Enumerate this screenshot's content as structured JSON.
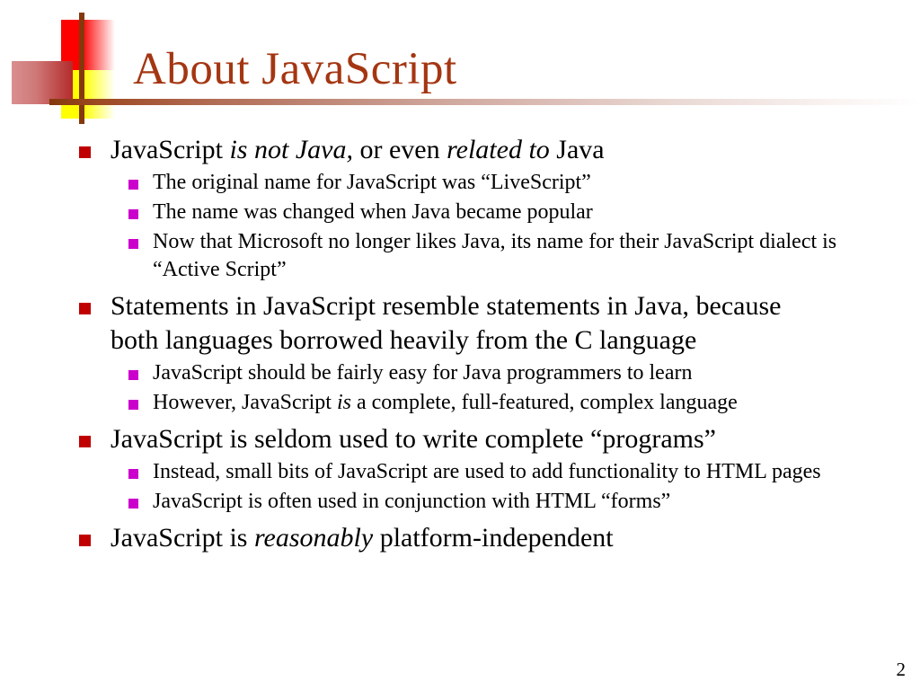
{
  "slide": {
    "title": "About JavaScript",
    "page_number": "2",
    "colors": {
      "title": "#a43612",
      "rule": "#85380c",
      "level1_bullet": "#c00000",
      "level2_bullet": "#cc00cc",
      "logo_red": "#fe0000",
      "logo_yellow": "#ffff00",
      "logo_rose": "#cf7878",
      "logo_cross": "#85380c",
      "text": "#000000",
      "background": "#ffffff"
    },
    "bullets": [
      {
        "level": 1,
        "runs": [
          {
            "text": "JavaScript ",
            "italic": false
          },
          {
            "text": "is not Java,",
            "italic": true
          },
          {
            "text": " or even ",
            "italic": false
          },
          {
            "text": "related to",
            "italic": true
          },
          {
            "text": " Java",
            "italic": false
          }
        ]
      },
      {
        "level": 2,
        "runs": [
          {
            "text": "The original name for JavaScript was “LiveScript”",
            "italic": false
          }
        ]
      },
      {
        "level": 2,
        "runs": [
          {
            "text": "The name was changed when Java became popular",
            "italic": false
          }
        ]
      },
      {
        "level": 2,
        "runs": [
          {
            "text": "Now that Microsoft no longer likes Java, its name for their JavaScript dialect is “Active Script”",
            "italic": false
          }
        ]
      },
      {
        "level": 1,
        "runs": [
          {
            "text": "Statements in JavaScript resemble statements in Java, because both languages borrowed heavily from the C language",
            "italic": false
          }
        ]
      },
      {
        "level": 2,
        "runs": [
          {
            "text": "JavaScript should be fairly easy for Java programmers to learn",
            "italic": false
          }
        ]
      },
      {
        "level": 2,
        "runs": [
          {
            "text": "However, JavaScript ",
            "italic": false
          },
          {
            "text": "is",
            "italic": true
          },
          {
            "text": " a complete, full-featured, complex language",
            "italic": false
          }
        ]
      },
      {
        "level": 1,
        "runs": [
          {
            "text": "JavaScript is seldom used to write complete “programs”",
            "italic": false
          }
        ]
      },
      {
        "level": 2,
        "runs": [
          {
            "text": "Instead, small bits of JavaScript are used to add functionality to HTML pages",
            "italic": false
          }
        ]
      },
      {
        "level": 2,
        "runs": [
          {
            "text": "JavaScript is often used in conjunction with HTML “forms”",
            "italic": false
          }
        ]
      },
      {
        "level": 1,
        "runs": [
          {
            "text": "JavaScript is ",
            "italic": false
          },
          {
            "text": "reasonably",
            "italic": true
          },
          {
            "text": " platform-independent",
            "italic": false
          }
        ]
      }
    ]
  }
}
